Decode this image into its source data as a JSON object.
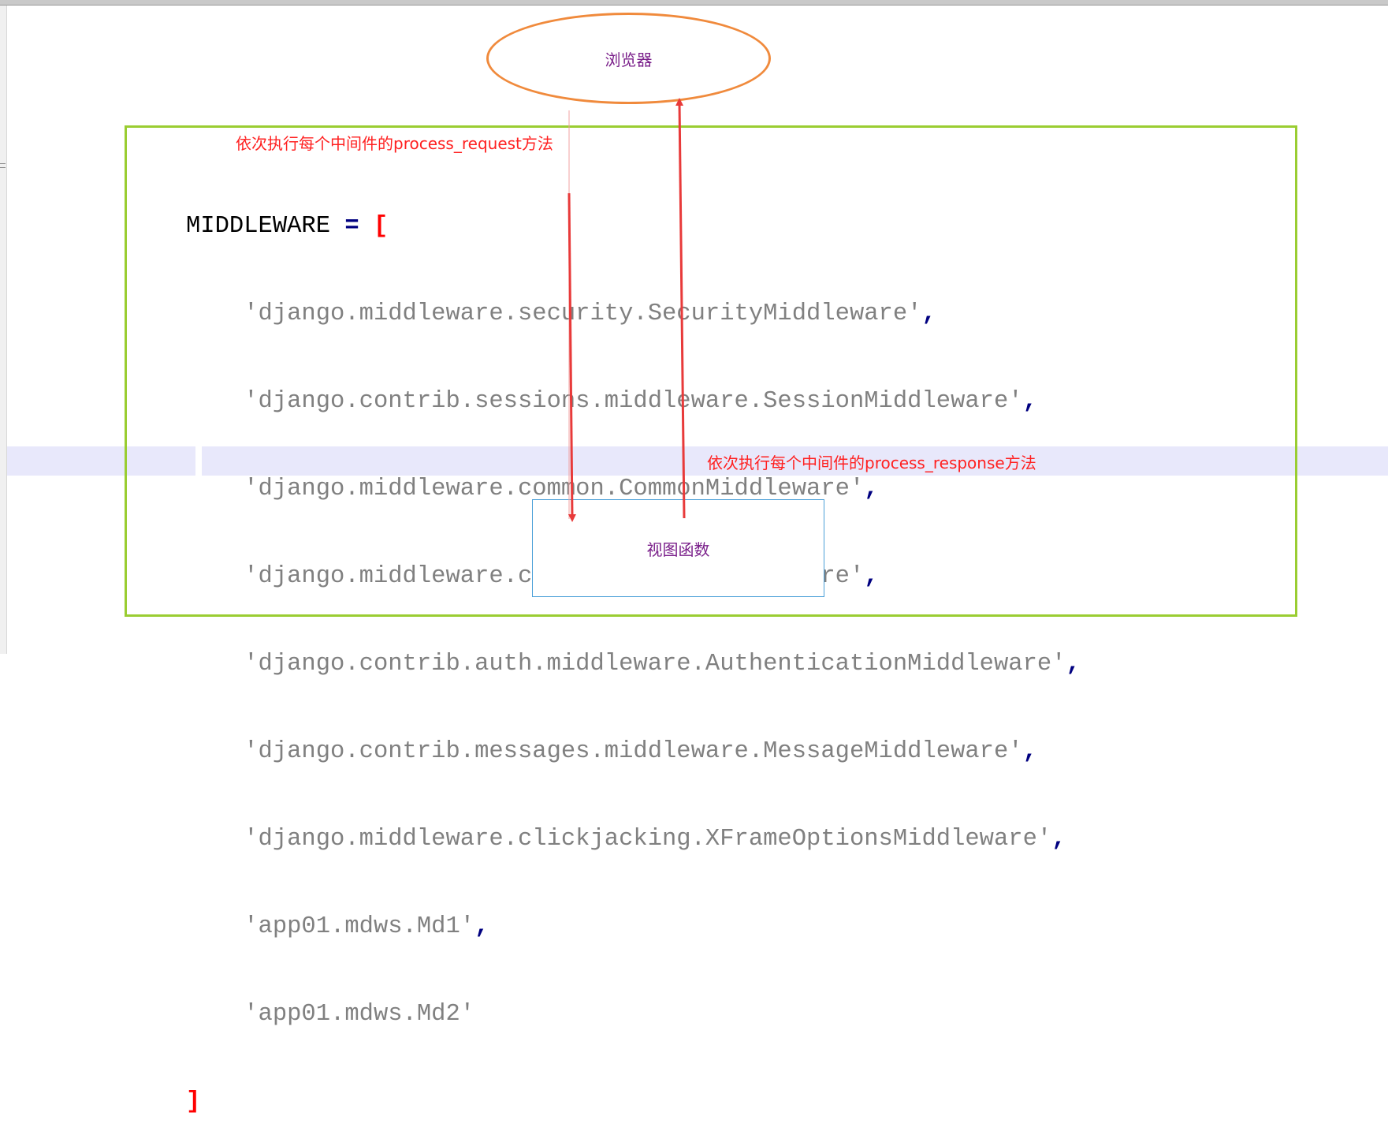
{
  "colors": {
    "frame": "#9acd32",
    "ellipse": "#f08a3c",
    "view_box": "#4a9fd8",
    "node_text": "#7a1f8a",
    "annotation": "#ff2020",
    "arrow": "#e83a3a"
  },
  "nodes": {
    "browser": "浏览器",
    "view_function": "视图函数"
  },
  "annotations": {
    "request": "依次执行每个中间件的process_request方法",
    "response": "依次执行每个中间件的process_response方法"
  },
  "code": {
    "header_ident": "MIDDLEWARE",
    "header_op": " = ",
    "open_bracket": "[",
    "close_bracket": "]",
    "entries": [
      {
        "text": "'django.middleware.security.SecurityMiddleware'",
        "comma": ","
      },
      {
        "text": "'django.contrib.sessions.middleware.SessionMiddleware'",
        "comma": ","
      },
      {
        "text": "'django.middleware.common.CommonMiddleware'",
        "comma": ","
      },
      {
        "text": "'django.middleware.csrf.CsrfViewMiddleware'",
        "comma": ","
      },
      {
        "text": "'django.contrib.auth.middleware.AuthenticationMiddleware'",
        "comma": ","
      },
      {
        "text": "'django.contrib.messages.middleware.MessageMiddleware'",
        "comma": ","
      },
      {
        "text": "'django.middleware.clickjacking.XFrameOptionsMiddleware'",
        "comma": ","
      },
      {
        "text": "'app01.mdws.Md1'",
        "comma": ","
      },
      {
        "text": "'app01.mdws.Md2'",
        "comma": ""
      }
    ]
  }
}
